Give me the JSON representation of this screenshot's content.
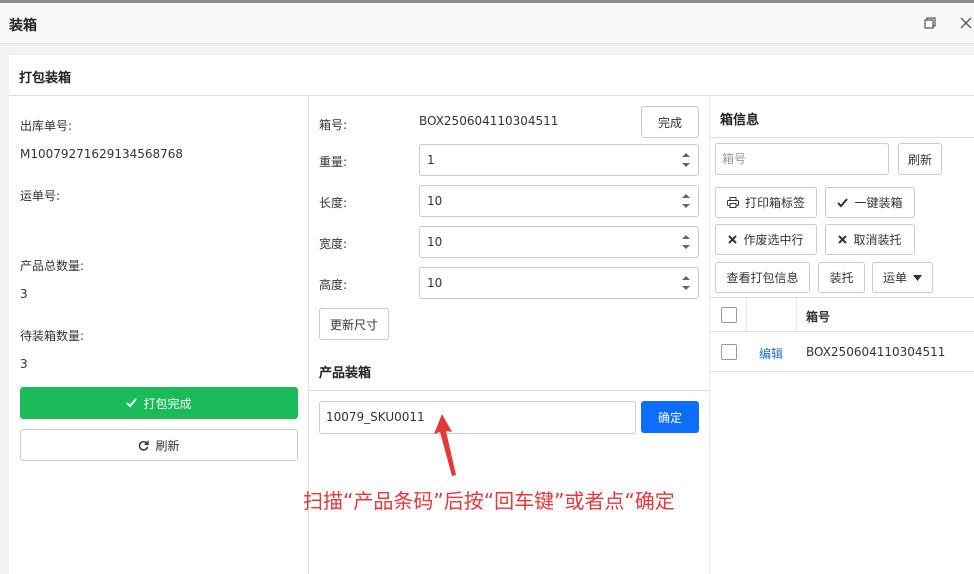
{
  "window": {
    "title": "装箱"
  },
  "panel": {
    "title": "打包装箱"
  },
  "left": {
    "outbound_label": "出库单号:",
    "outbound_value": "M10079271629134568768",
    "waybill_label": "运单号:",
    "waybill_value": "",
    "total_qty_label": "产品总数量:",
    "total_qty_value": "3",
    "pending_qty_label": "待装箱数量:",
    "pending_qty_value": "3",
    "pack_done_label": "打包完成",
    "refresh_label": "刷新"
  },
  "middle": {
    "box_no_label": "箱号:",
    "box_no_value": "BOX250604110304511",
    "finish_label": "完成",
    "weight_label": "重量:",
    "weight_value": "1",
    "length_label": "长度:",
    "length_value": "10",
    "width_label": "宽度:",
    "width_value": "10",
    "height_label": "高度:",
    "height_value": "10",
    "update_size_label": "更新尺寸",
    "product_pack_title": "产品装箱",
    "barcode_value": "10079_SKU0011",
    "confirm_label": "确定"
  },
  "right": {
    "title": "箱信息",
    "box_search_placeholder": "箱号",
    "refresh_label": "刷新",
    "print_label_btn": "打印箱标签",
    "one_click_pack_btn": "一键装箱",
    "void_selected_btn": "作废选中行",
    "cancel_pallet_btn": "取消装托",
    "view_pack_info_btn": "查看打包信息",
    "pallet_btn": "装托",
    "waybill_btn": "运单",
    "table": {
      "header_box_no": "箱号",
      "rows": [
        {
          "action": "编辑",
          "box_no": "BOX250604110304511"
        }
      ]
    }
  },
  "annotation": {
    "text": "扫描“产品条码”后按“回车键”或者点“确定"
  },
  "colors": {
    "green": "#1cbb5a",
    "blue": "#0d6efd",
    "annotation_red": "#e5383b",
    "link_blue": "#1f6fd1"
  }
}
